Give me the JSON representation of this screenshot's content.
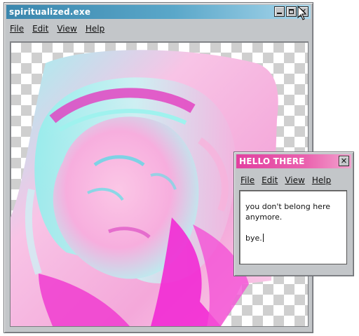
{
  "main_window": {
    "title": "spiritualized.exe",
    "menu": [
      "File",
      "Edit",
      "View",
      "Help"
    ],
    "title_buttons": [
      "minimize-icon",
      "maximize-icon",
      "close-icon"
    ]
  },
  "dialog": {
    "title": "HELLO THERE",
    "close_glyph": "✕",
    "menu": [
      "File",
      "Edit",
      "View",
      "Help"
    ],
    "message_line1": "you don't belong here anymore.",
    "message_line2": "bye."
  },
  "colors": {
    "main_titlebar": "#3a86ad",
    "dialog_titlebar": "#e23fa0",
    "window_face": "#c3c6c9",
    "art_pink": "#f7b3dc",
    "art_cyan": "#8ff0ec",
    "art_magenta": "#f22ad4"
  },
  "image": {
    "description_icon": "holographic-portrait-image"
  }
}
